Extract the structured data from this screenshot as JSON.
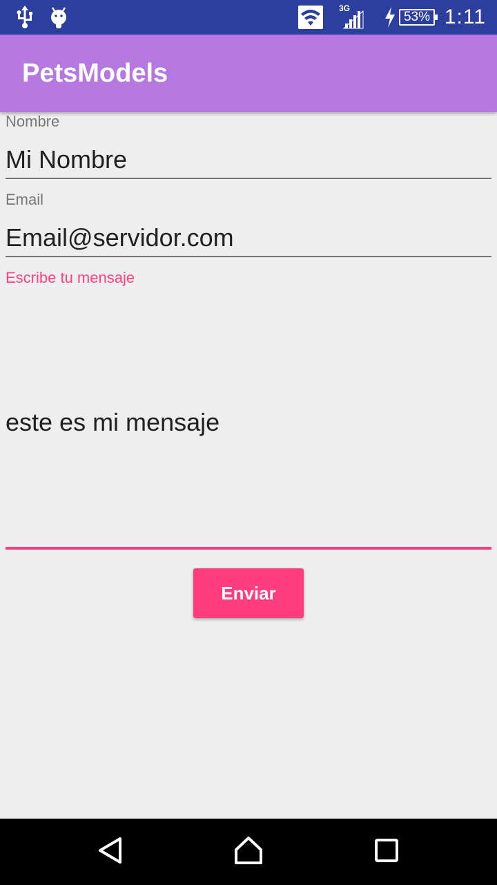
{
  "status_bar": {
    "network_type": "3G",
    "battery_percent": "53%",
    "time": "1:11",
    "icons": [
      "usb-icon",
      "android-debug-icon",
      "wifi-icon",
      "signal-icon",
      "charging-bolt-icon",
      "battery-icon"
    ]
  },
  "app_bar": {
    "title": "PetsModels",
    "color": "#b478e0"
  },
  "form": {
    "name": {
      "label": "Nombre",
      "value": "Mi Nombre"
    },
    "email": {
      "label": "Email",
      "value": "Email@servidor.com"
    },
    "message": {
      "label": "Escribe tu mensaje",
      "value": "este es mi mensaje"
    },
    "submit_label": "Enviar",
    "accent_color": "#ff4081"
  },
  "nav_bar": {
    "icons": [
      "back-icon",
      "home-icon",
      "recent-apps-icon"
    ]
  }
}
